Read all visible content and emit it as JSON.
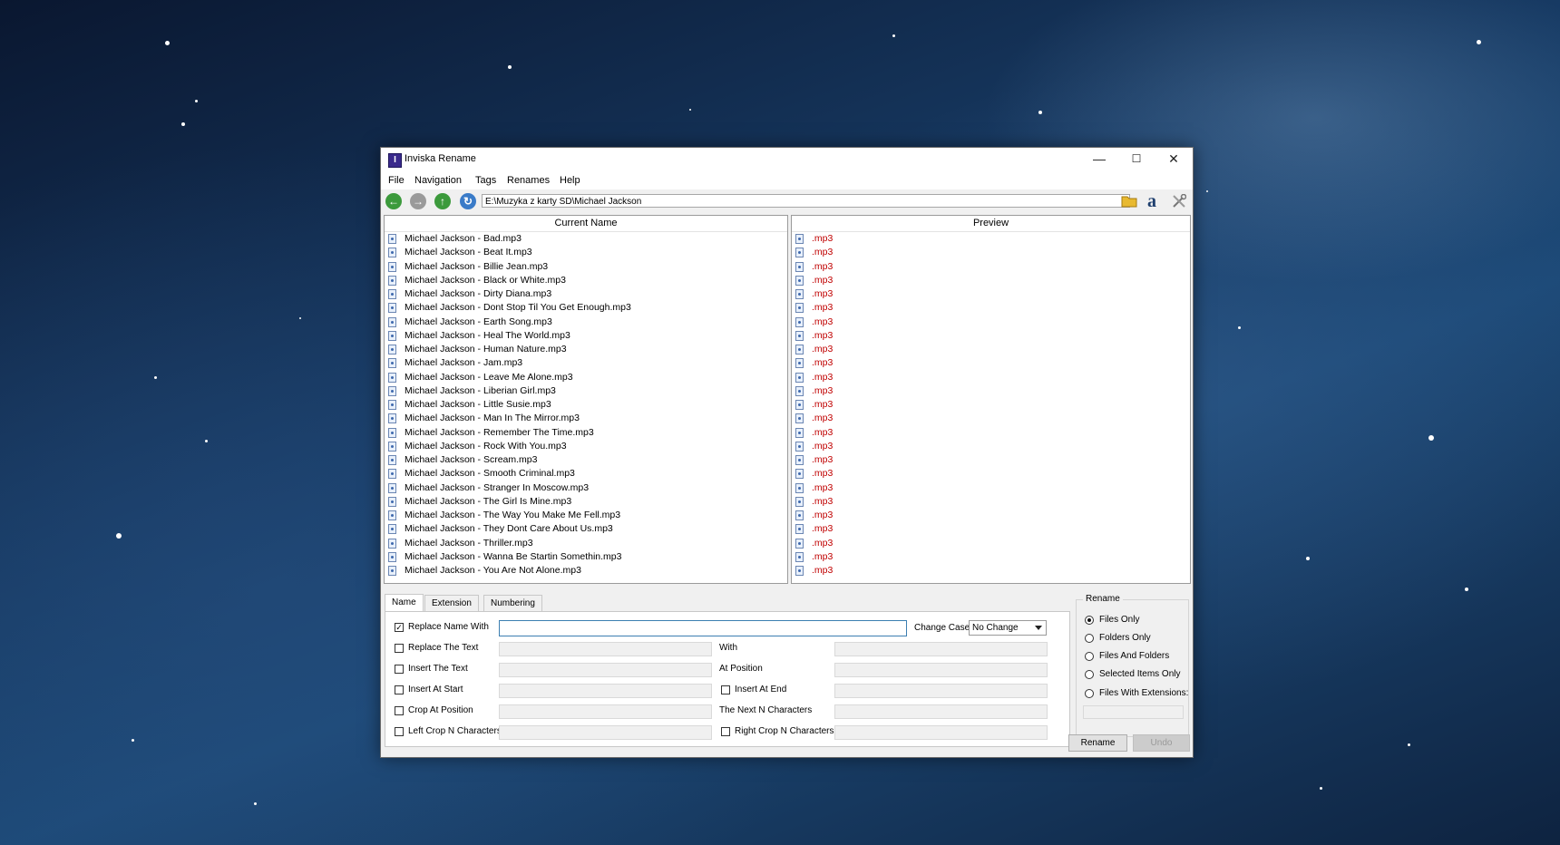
{
  "window": {
    "title": "Inviska Rename",
    "minimize_glyph": "—",
    "maximize_glyph": "☐",
    "close_glyph": "✕"
  },
  "menu": [
    "File",
    "Navigation",
    "Tags",
    "Renames",
    "Help"
  ],
  "toolbar": {
    "path": "E:\\Muzyka z karty SD\\Michael Jackson",
    "icons": [
      "back-arrow-icon",
      "forward-arrow-icon",
      "up-arrow-icon",
      "refresh-icon",
      "open-folder-icon",
      "amazon-icon",
      "tools-icon"
    ]
  },
  "current_panel": {
    "header": "Current Name",
    "files": [
      "Michael Jackson - Bad.mp3",
      "Michael Jackson - Beat It.mp3",
      "Michael Jackson - Billie Jean.mp3",
      "Michael Jackson - Black or White.mp3",
      "Michael Jackson - Dirty Diana.mp3",
      "Michael Jackson - Dont Stop Til You Get Enough.mp3",
      "Michael Jackson - Earth Song.mp3",
      "Michael Jackson - Heal The World.mp3",
      "Michael Jackson - Human Nature.mp3",
      "Michael Jackson - Jam.mp3",
      "Michael Jackson - Leave Me Alone.mp3",
      "Michael Jackson - Liberian Girl.mp3",
      "Michael Jackson - Little Susie.mp3",
      "Michael Jackson - Man In The Mirror.mp3",
      "Michael Jackson - Remember The Time.mp3",
      "Michael Jackson - Rock With You.mp3",
      "Michael Jackson - Scream.mp3",
      "Michael Jackson - Smooth Criminal.mp3",
      "Michael Jackson - Stranger In Moscow.mp3",
      "Michael Jackson - The Girl Is Mine.mp3",
      "Michael Jackson - The Way You Make Me Fell.mp3",
      "Michael Jackson - They Dont Care About Us.mp3",
      "Michael Jackson - Thriller.mp3",
      "Michael Jackson - Wanna Be Startin Somethin.mp3",
      "Michael Jackson - You Are Not Alone.mp3"
    ]
  },
  "preview_panel": {
    "header": "Preview",
    "files": [
      ".mp3",
      ".mp3",
      ".mp3",
      ".mp3",
      ".mp3",
      ".mp3",
      ".mp3",
      ".mp3",
      ".mp3",
      ".mp3",
      ".mp3",
      ".mp3",
      ".mp3",
      ".mp3",
      ".mp3",
      ".mp3",
      ".mp3",
      ".mp3",
      ".mp3",
      ".mp3",
      ".mp3",
      ".mp3",
      ".mp3",
      ".mp3",
      ".mp3"
    ],
    "text_color": "#c00000"
  },
  "tabs": [
    "Name",
    "Extension",
    "Numbering"
  ],
  "active_tab": "Name",
  "name_options": {
    "replace_name_with": {
      "label": "Replace Name With",
      "checked": true,
      "value": "",
      "check_glyph": "✓"
    },
    "change_case": {
      "label": "Change Case",
      "value": "No Change"
    },
    "replace_the_text": {
      "label": "Replace The Text",
      "checked": false
    },
    "with": {
      "label": "With"
    },
    "insert_the_text": {
      "label": "Insert The Text",
      "checked": false
    },
    "at_position": {
      "label": "At Position"
    },
    "insert_at_start": {
      "label": "Insert At Start",
      "checked": false
    },
    "insert_at_end": {
      "label": "Insert At End",
      "checked": false
    },
    "crop_at_position": {
      "label": "Crop At Position",
      "checked": false
    },
    "next_n_characters": {
      "label": "The Next N Characters"
    },
    "left_crop": {
      "label": "Left Crop N Characters",
      "checked": false
    },
    "right_crop": {
      "label": "Right Crop N Characters",
      "checked": false
    }
  },
  "rename_group": {
    "title": "Rename",
    "options": [
      "Files Only",
      "Folders Only",
      "Files And Folders",
      "Selected Items Only",
      "Files With Extensions:"
    ],
    "selected": "Files Only",
    "extensions_value": ""
  },
  "buttons": {
    "rename": "Rename",
    "undo": "Undo"
  }
}
